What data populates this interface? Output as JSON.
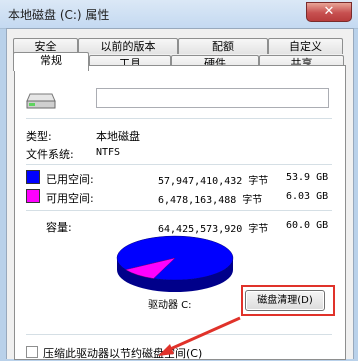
{
  "window": {
    "title": "本地磁盘 (C:) 属性",
    "close_symbol": "✕"
  },
  "tabs": {
    "row1": [
      "安全",
      "以前的版本",
      "配额",
      "自定义"
    ],
    "row2": [
      "常规",
      "工具",
      "硬件",
      "共享"
    ],
    "active": "常规"
  },
  "general": {
    "drive_name_value": "",
    "type_label": "类型:",
    "type_value": "本地磁盘",
    "fs_label": "文件系统:",
    "fs_value": "NTFS",
    "used": {
      "label": "已用空间:",
      "bytes": "57,947,410,432 字节",
      "size": "53.9 GB",
      "color": "#0000ff"
    },
    "free": {
      "label": "可用空间:",
      "bytes": "6,478,163,488 字节",
      "size": "6.03 GB",
      "color": "#ff00ff"
    },
    "capacity": {
      "label": "容量:",
      "bytes": "64,425,573,920 字节",
      "size": "60.0 GB"
    },
    "drive_label": "驱动器 C:",
    "cleanup_button": "磁盘清理(D)",
    "compress_label": "压缩此驱动器以节约磁盘空间(C)"
  },
  "pie": {
    "used_fraction": 0.899,
    "free_fraction": 0.101
  },
  "icons": {
    "drive": "hard-drive-icon"
  },
  "colors": {
    "annotation": "#e0322a"
  }
}
